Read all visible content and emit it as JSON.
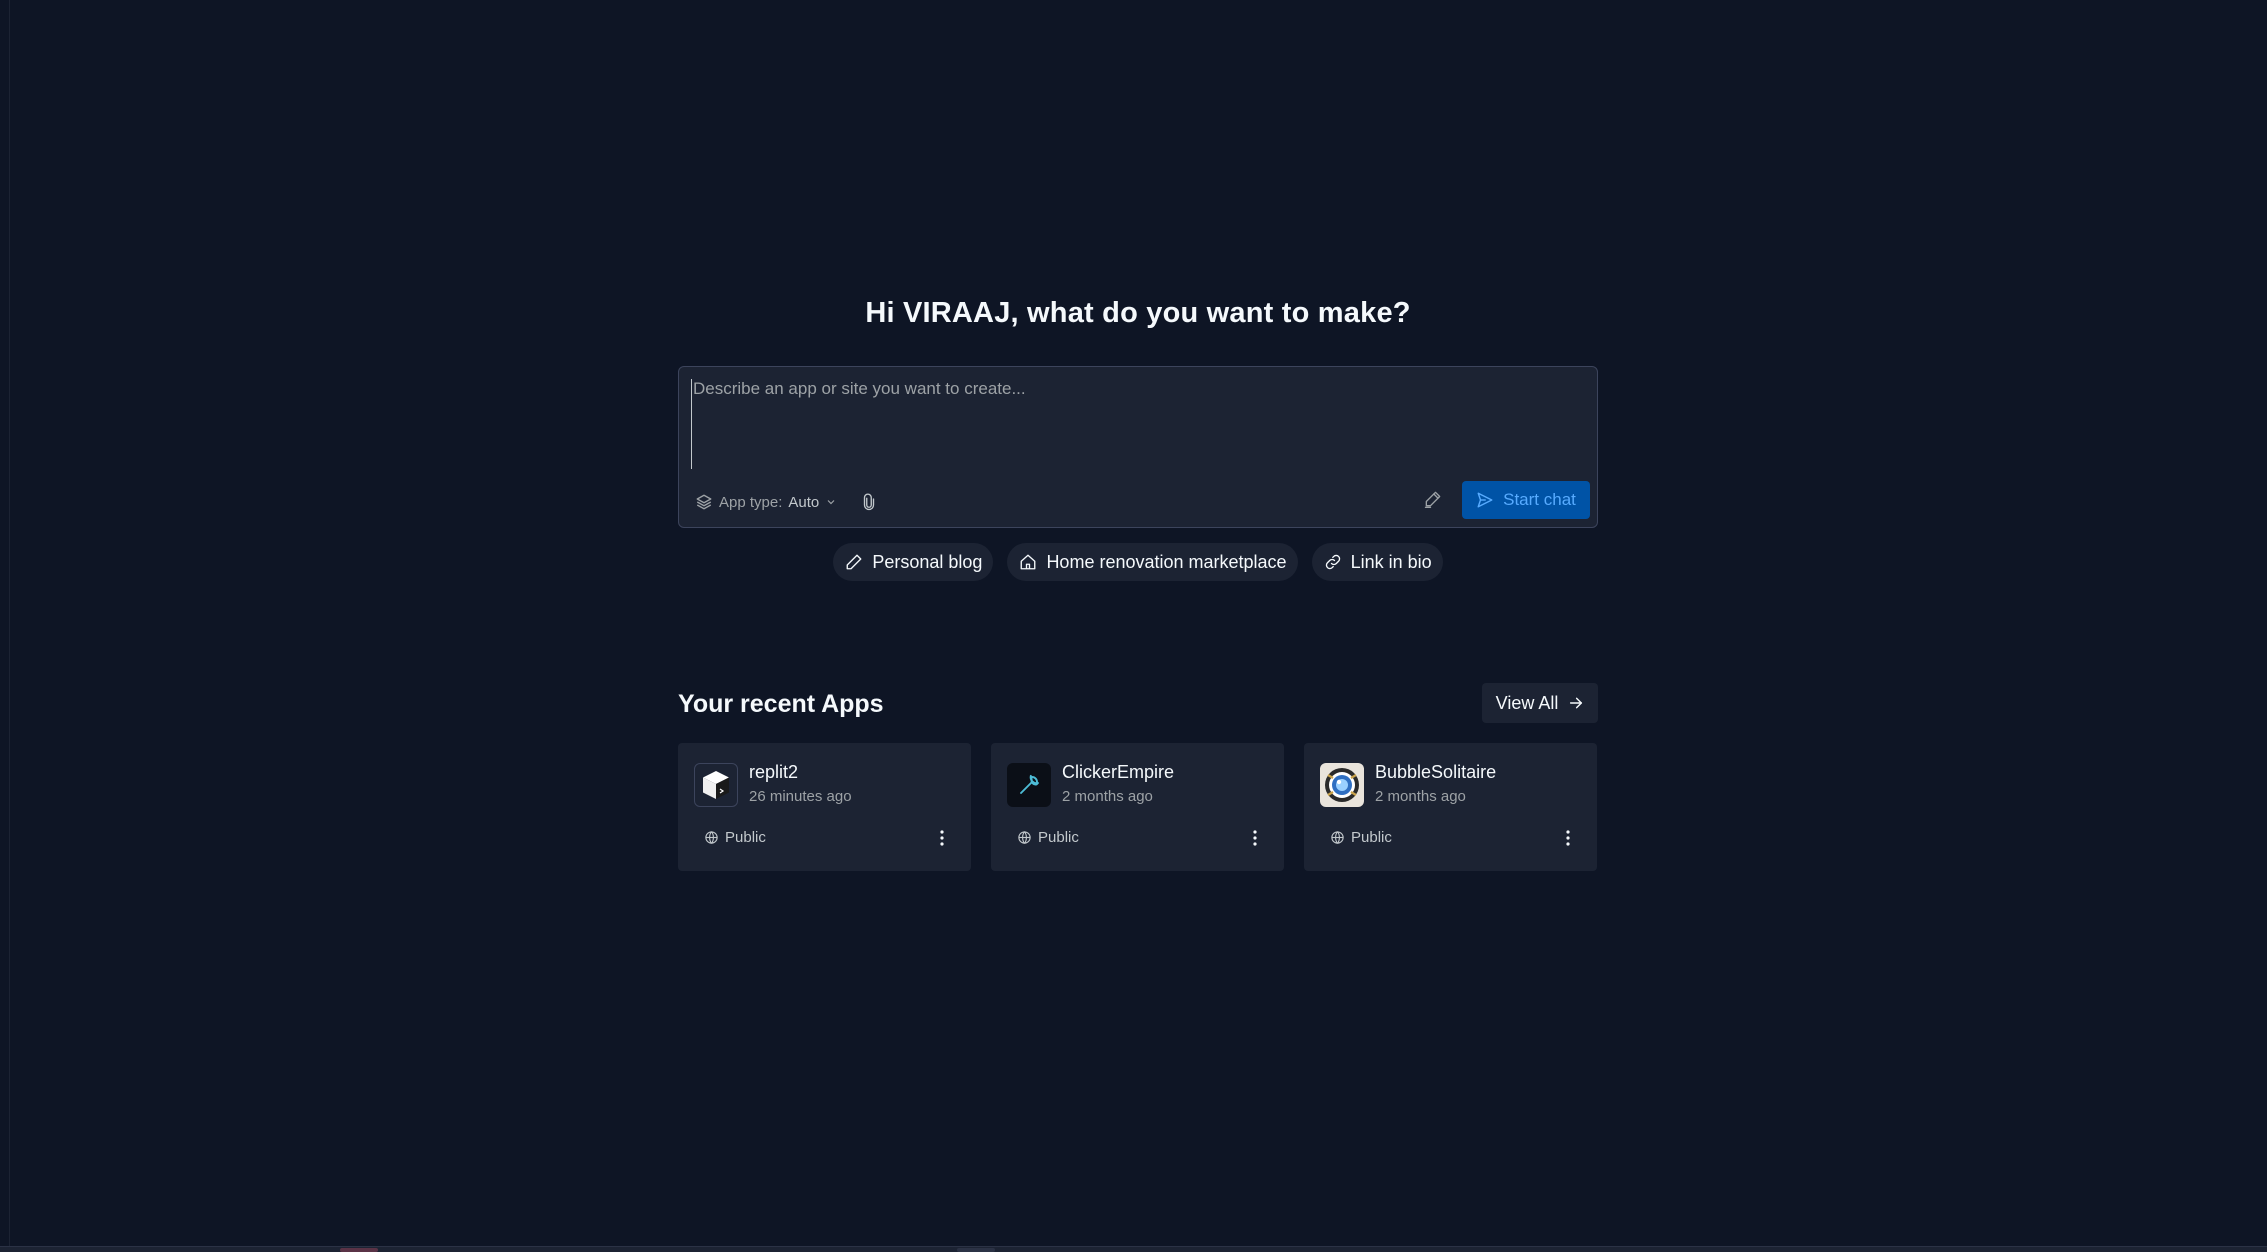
{
  "greeting": "Hi VIRAAJ, what do you want to make?",
  "composer": {
    "placeholder": "Describe an app or site you want to create...",
    "app_type_label": "App type:",
    "app_type_value": "Auto",
    "start_label": "Start chat"
  },
  "suggestions": [
    {
      "label": "Personal blog",
      "icon": "pencil-icon"
    },
    {
      "label": "Home renovation marketplace",
      "icon": "home-icon"
    },
    {
      "label": "Link in bio",
      "icon": "link-icon"
    }
  ],
  "recent": {
    "title": "Your recent Apps",
    "view_all_label": "View All",
    "apps": [
      {
        "name": "replit2",
        "time": "26 minutes ago",
        "visibility": "Public",
        "icon": "cube-icon"
      },
      {
        "name": "ClickerEmpire",
        "time": "2 months ago",
        "visibility": "Public",
        "icon": "wrench-icon"
      },
      {
        "name": "BubbleSolitaire",
        "time": "2 months ago",
        "visibility": "Public",
        "icon": "bubble-icon"
      }
    ]
  },
  "colors": {
    "background": "#0e1525",
    "surface": "#1c2333",
    "accent": "#0053a6",
    "accent_text": "#57abff"
  }
}
